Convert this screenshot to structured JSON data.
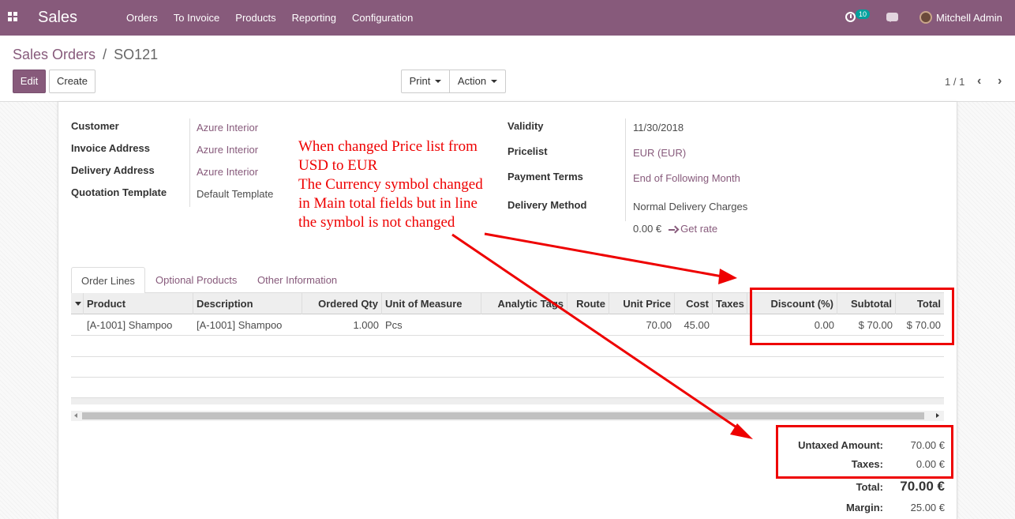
{
  "navbar": {
    "app_name": "Sales",
    "menu": [
      "Orders",
      "To Invoice",
      "Products",
      "Reporting",
      "Configuration"
    ],
    "activity_count": "10",
    "user_name": "Mitchell Admin"
  },
  "control_panel": {
    "breadcrumb_parent": "Sales Orders",
    "breadcrumb_sep": "/",
    "breadcrumb_current": "SO121",
    "edit_label": "Edit",
    "create_label": "Create",
    "print_label": "Print",
    "action_label": "Action",
    "pager": "1 / 1"
  },
  "form": {
    "left": [
      {
        "label": "Customer",
        "value": "Azure Interior"
      },
      {
        "label": "Invoice Address",
        "value": "Azure Interior"
      },
      {
        "label": "Delivery Address",
        "value": "Azure Interior"
      },
      {
        "label": "Quotation Template",
        "value": "Default Template"
      }
    ],
    "right": [
      {
        "label": "Validity",
        "value": "11/30/2018"
      },
      {
        "label": "Pricelist",
        "value": "EUR (EUR)"
      },
      {
        "label": "Payment Terms",
        "value": "End of Following Month"
      },
      {
        "label": "Delivery Method",
        "value": "Normal Delivery Charges"
      }
    ],
    "delivery_price": "0.00 €",
    "get_rate_label": "Get rate"
  },
  "annotation": {
    "lines": [
      "When changed Price list from",
      "USD to EUR",
      "The Currency symbol changed",
      "in Main total fields but in line",
      "the symbol is not changed"
    ],
    "color": "#ee0000"
  },
  "tabs": [
    "Order Lines",
    "Optional Products",
    "Other Information"
  ],
  "table": {
    "columns": [
      "Product",
      "Description",
      "Ordered Qty",
      "Unit of Measure",
      "Analytic Tags",
      "Route",
      "Unit Price",
      "Cost",
      "Taxes",
      "Discount (%)",
      "Subtotal",
      "Total"
    ],
    "rows": [
      [
        "[A-1001] Shampoo",
        "[A-1001] Shampoo",
        "1.000",
        "Pcs",
        "",
        "",
        "70.00",
        "45.00",
        "",
        "0.00",
        "$ 70.00",
        "$ 70.00"
      ]
    ]
  },
  "totals": {
    "untaxed_label": "Untaxed Amount:",
    "untaxed_value": "70.00 €",
    "taxes_label": "Taxes:",
    "taxes_value": "0.00 €",
    "total_label": "Total:",
    "total_value": "70.00 €",
    "margin_label": "Margin:",
    "margin_value": "25.00 €"
  },
  "colors": {
    "brand": "#875a7b",
    "highlight": "#ee0000"
  }
}
